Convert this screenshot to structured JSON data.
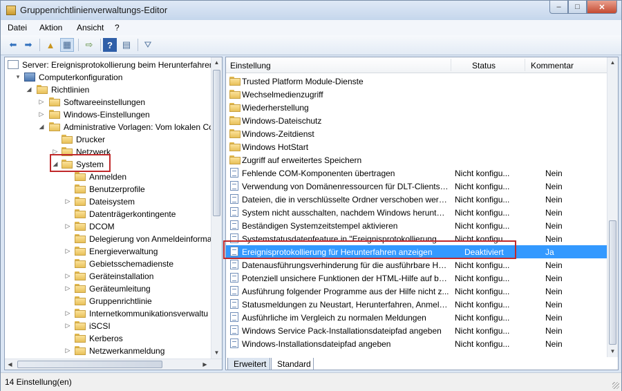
{
  "window": {
    "title": "Gruppenrichtlinienverwaltungs-Editor"
  },
  "window_buttons": {
    "minimize": "–",
    "maximize": "□",
    "close": "✕"
  },
  "menu": [
    "Datei",
    "Aktion",
    "Ansicht",
    "?"
  ],
  "toolbar_icons": [
    "back-arrow-icon",
    "forward-arrow-icon",
    "folder-up-icon",
    "show-hide-tree-icon",
    "export-list-icon",
    "help-icon",
    "properties-icon",
    "filter-icon"
  ],
  "tree": [
    {
      "label": "Server: Ereignisprotokollierung beim Herunterfahren",
      "level": 0,
      "expander": "",
      "icon": "document-icon"
    },
    {
      "label": "Computerkonfiguration",
      "level": 0,
      "expander": "▾",
      "icon": "computer-icon"
    },
    {
      "label": "Richtlinien",
      "level": 1,
      "expander": "◢",
      "icon": "folder-icon"
    },
    {
      "label": "Softwareeinstellungen",
      "level": 2,
      "expander": "▷",
      "icon": "folder-icon"
    },
    {
      "label": "Windows-Einstellungen",
      "level": 2,
      "expander": "▷",
      "icon": "folder-icon"
    },
    {
      "label": "Administrative Vorlagen: Vom lokalen Co",
      "level": 2,
      "expander": "◢",
      "icon": "folder-icon"
    },
    {
      "label": "Drucker",
      "level": 3,
      "expander": "",
      "icon": "folder-icon"
    },
    {
      "label": "Netzwerk",
      "level": 3,
      "expander": "▷",
      "icon": "folder-icon"
    },
    {
      "label": "System",
      "level": 3,
      "expander": "◢",
      "icon": "folder-icon",
      "highlight": true
    },
    {
      "label": "Anmelden",
      "level": 4,
      "expander": "",
      "icon": "folder-icon"
    },
    {
      "label": "Benutzerprofile",
      "level": 4,
      "expander": "",
      "icon": "folder-icon"
    },
    {
      "label": "Dateisystem",
      "level": 4,
      "expander": "▷",
      "icon": "folder-icon"
    },
    {
      "label": "Datenträgerkontingente",
      "level": 4,
      "expander": "",
      "icon": "folder-icon"
    },
    {
      "label": "DCOM",
      "level": 4,
      "expander": "▷",
      "icon": "folder-icon"
    },
    {
      "label": "Delegierung von Anmeldeinforma",
      "level": 4,
      "expander": "",
      "icon": "folder-icon"
    },
    {
      "label": "Energieverwaltung",
      "level": 4,
      "expander": "▷",
      "icon": "folder-icon"
    },
    {
      "label": "Gebietsschemadienste",
      "level": 4,
      "expander": "",
      "icon": "folder-icon"
    },
    {
      "label": "Geräteinstallation",
      "level": 4,
      "expander": "▷",
      "icon": "folder-icon"
    },
    {
      "label": "Geräteumleitung",
      "level": 4,
      "expander": "▷",
      "icon": "folder-icon"
    },
    {
      "label": "Gruppenrichtlinie",
      "level": 4,
      "expander": "",
      "icon": "folder-icon"
    },
    {
      "label": "Internetkommunikationsverwaltu",
      "level": 4,
      "expander": "▷",
      "icon": "folder-icon"
    },
    {
      "label": "iSCSI",
      "level": 4,
      "expander": "▷",
      "icon": "folder-icon"
    },
    {
      "label": "Kerberos",
      "level": 4,
      "expander": "",
      "icon": "folder-icon"
    },
    {
      "label": "Netzwerkanmeldung",
      "level": 4,
      "expander": "▷",
      "icon": "folder-icon"
    }
  ],
  "list": {
    "headers": {
      "setting": "Einstellung",
      "status": "Status",
      "comment": "Kommentar"
    },
    "rows": [
      {
        "name": "Trusted Platform Module-Dienste",
        "status": "",
        "comment": "",
        "type": "folder"
      },
      {
        "name": "Wechselmedienzugriff",
        "status": "",
        "comment": "",
        "type": "folder"
      },
      {
        "name": "Wiederherstellung",
        "status": "",
        "comment": "",
        "type": "folder"
      },
      {
        "name": "Windows-Dateischutz",
        "status": "",
        "comment": "",
        "type": "folder"
      },
      {
        "name": "Windows-Zeitdienst",
        "status": "",
        "comment": "",
        "type": "folder"
      },
      {
        "name": "Windows HotStart",
        "status": "",
        "comment": "",
        "type": "folder"
      },
      {
        "name": "Zugriff auf erweitertes Speichern",
        "status": "",
        "comment": "",
        "type": "folder"
      },
      {
        "name": "Fehlende COM-Komponenten übertragen",
        "status": "Nicht konfigu...",
        "comment": "Nein",
        "type": "policy"
      },
      {
        "name": "Verwendung von Domänenressourcen für DLT-Clients (...",
        "status": "Nicht konfigu...",
        "comment": "Nein",
        "type": "policy"
      },
      {
        "name": "Dateien, die in verschlüsselte Ordner verschoben werde...",
        "status": "Nicht konfigu...",
        "comment": "Nein",
        "type": "policy"
      },
      {
        "name": "System nicht ausschalten, nachdem Windows herunter...",
        "status": "Nicht konfigu...",
        "comment": "Nein",
        "type": "policy"
      },
      {
        "name": "Beständigen Systemzeitstempel aktivieren",
        "status": "Nicht konfigu...",
        "comment": "Nein",
        "type": "policy"
      },
      {
        "name": "Systemstatusdatenfeature in \"Ereignisprotokollierung fü...",
        "status": "Nicht konfigu...",
        "comment": "Nein",
        "type": "policy"
      },
      {
        "name": "Ereignisprotokollierung für Herunterfahren anzeigen",
        "status": "Deaktiviert",
        "comment": "Ja",
        "type": "policy",
        "selected": true
      },
      {
        "name": "Datenausführungsverhinderung für die ausführbare HT...",
        "status": "Nicht konfigu...",
        "comment": "Nein",
        "type": "policy"
      },
      {
        "name": "Potenziell unsichere Funktionen der HTML-Hilfe auf be...",
        "status": "Nicht konfigu...",
        "comment": "Nein",
        "type": "policy"
      },
      {
        "name": "Ausführung folgender Programme aus der Hilfe nicht z...",
        "status": "Nicht konfigu...",
        "comment": "Nein",
        "type": "policy"
      },
      {
        "name": "Statusmeldungen zu Neustart, Herunterfahren, Anmeld...",
        "status": "Nicht konfigu...",
        "comment": "Nein",
        "type": "policy"
      },
      {
        "name": "Ausführliche im Vergleich zu normalen Meldungen",
        "status": "Nicht konfigu...",
        "comment": "Nein",
        "type": "policy"
      },
      {
        "name": "Windows Service Pack-Installationsdateipfad angeben",
        "status": "Nicht konfigu...",
        "comment": "Nein",
        "type": "policy"
      },
      {
        "name": "Windows-Installationsdateipfad angeben",
        "status": "Nicht konfigu...",
        "comment": "Nein",
        "type": "policy"
      }
    ]
  },
  "tabs": [
    "Erweitert",
    "Standard"
  ],
  "active_tab": "Standard",
  "statusbar": {
    "text": "14 Einstellung(en)"
  },
  "colors": {
    "selection": "#3399ff",
    "highlight_box": "#c0282a"
  }
}
